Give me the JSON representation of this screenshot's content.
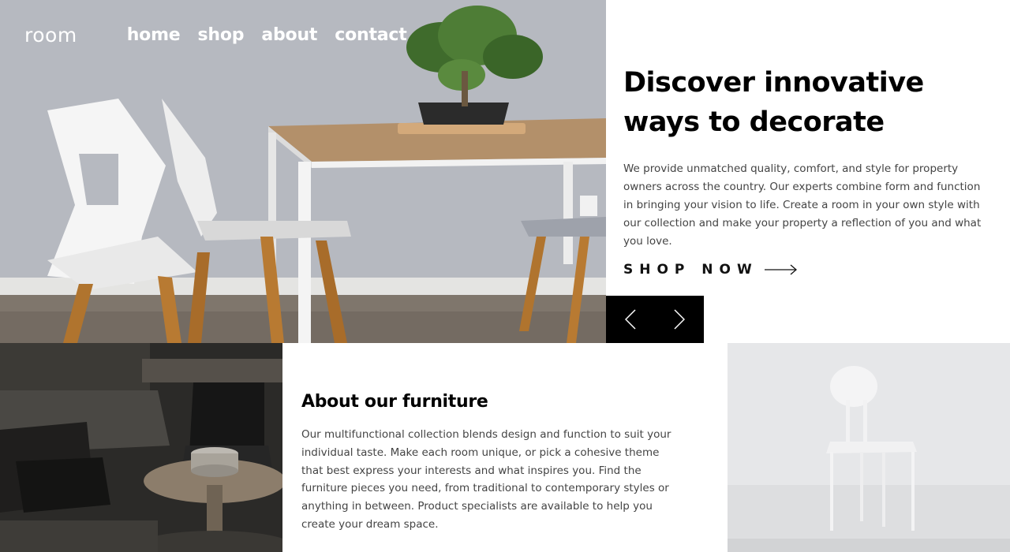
{
  "brand": {
    "logo": "room"
  },
  "nav": {
    "items": [
      {
        "label": "home"
      },
      {
        "label": "shop"
      },
      {
        "label": "about"
      },
      {
        "label": "contact"
      }
    ]
  },
  "hero": {
    "title": "Discover innovative ways to decorate",
    "description": "We provide unmatched quality, comfort, and style for property owners across the country. Our experts combine form and function in bringing your vision to life. Create a room in your own style with our collection and make your property a reflection of you and what you love.",
    "cta_label": "SHOP NOW",
    "cta_icon": "arrow-right-icon"
  },
  "slider": {
    "prev_icon": "chevron-left-icon",
    "next_icon": "chevron-right-icon"
  },
  "about": {
    "title": "About our furniture",
    "description": "Our multifunctional collection blends design and function to suit your individual taste. Make each room unique, or pick a cohesive theme that best express your interests and what inspires you. Find the furniture pieces you need, from traditional to contemporary styles or anything in between. Product specialists are available to help you create your dream space."
  },
  "colors": {
    "text": "#000000",
    "body_text": "#444444",
    "slider_bg": "#000000",
    "nav_text": "#ffffff"
  }
}
